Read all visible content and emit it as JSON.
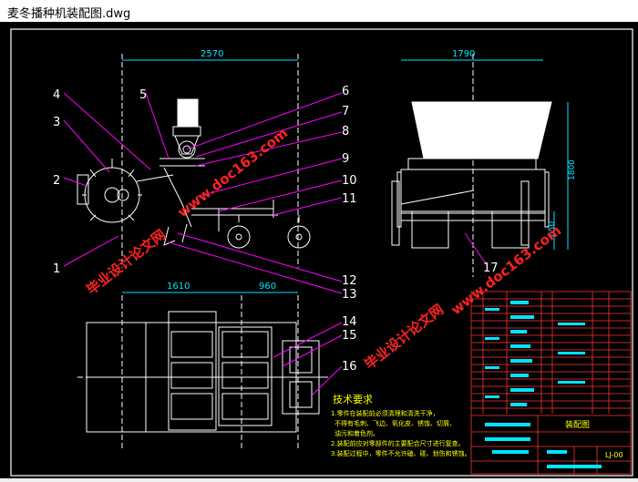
{
  "window": {
    "title": "麦冬播种机装配图.dwg"
  },
  "drawing": {
    "dimensions": {
      "side_width": "2570",
      "front_width": "1790",
      "front_height": "1800",
      "front_wheel_height": "650",
      "top_left": "1610",
      "top_right": "960"
    },
    "part_numbers": [
      "1",
      "2",
      "3",
      "4",
      "5",
      "6",
      "7",
      "8",
      "9",
      "10",
      "11",
      "12",
      "13",
      "14",
      "15",
      "16",
      "17"
    ],
    "watermark": {
      "site": "www.doc163.com",
      "brand": "毕业设计论文网"
    },
    "tech_title": "技术要求",
    "tech_notes": [
      "1.零件在装配前必须清理和清洗干净，",
      "不得有毛刺、飞边、氧化皮、锈蚀、切屑、",
      "油污和着色剂。",
      "2.装配前应对零部件的主要配合尺寸进行复查。",
      "3.装配过程中，零件不允许磕、碰、划伤和锈蚀。"
    ],
    "title_block": {
      "name": "装配图",
      "code": "LJ-00"
    }
  },
  "colors": {
    "frame": "#ffffff",
    "dim": "#00e5ff",
    "leader": "#ff00ff",
    "parts": "#ffffff",
    "watermark": "#ff2222",
    "table": "#ff3333",
    "notes": "#ffff00"
  }
}
